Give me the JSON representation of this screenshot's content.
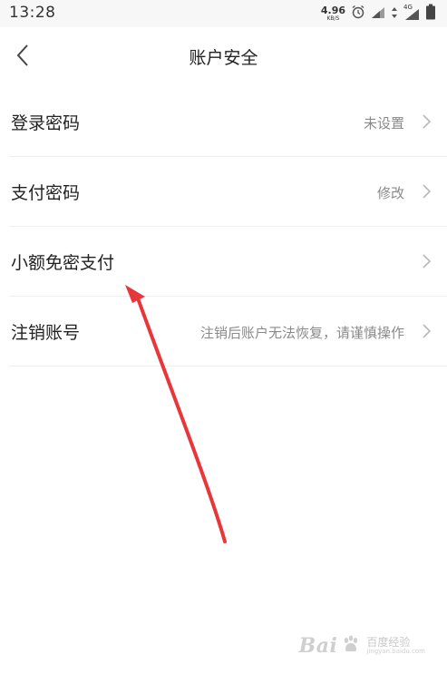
{
  "status_bar": {
    "time": "13:28",
    "net_speed": "4.96",
    "net_unit": "KB/S",
    "network_type": "4G"
  },
  "nav": {
    "title": "账户安全"
  },
  "menu": {
    "items": [
      {
        "label": "登录密码",
        "value": "未设置"
      },
      {
        "label": "支付密码",
        "value": "修改"
      },
      {
        "label": "小额免密支付",
        "value": ""
      },
      {
        "label": "注销账号",
        "value": "注销后账户无法恢复，请谨慎操作"
      }
    ]
  },
  "watermark": {
    "brand": "Bai",
    "cn": "百度经验",
    "url": "jingyan.baidu.com"
  },
  "colors": {
    "annotation_arrow": "#e8373b",
    "secondary_text": "#8a8a8a",
    "divider": "#eeeeee"
  }
}
